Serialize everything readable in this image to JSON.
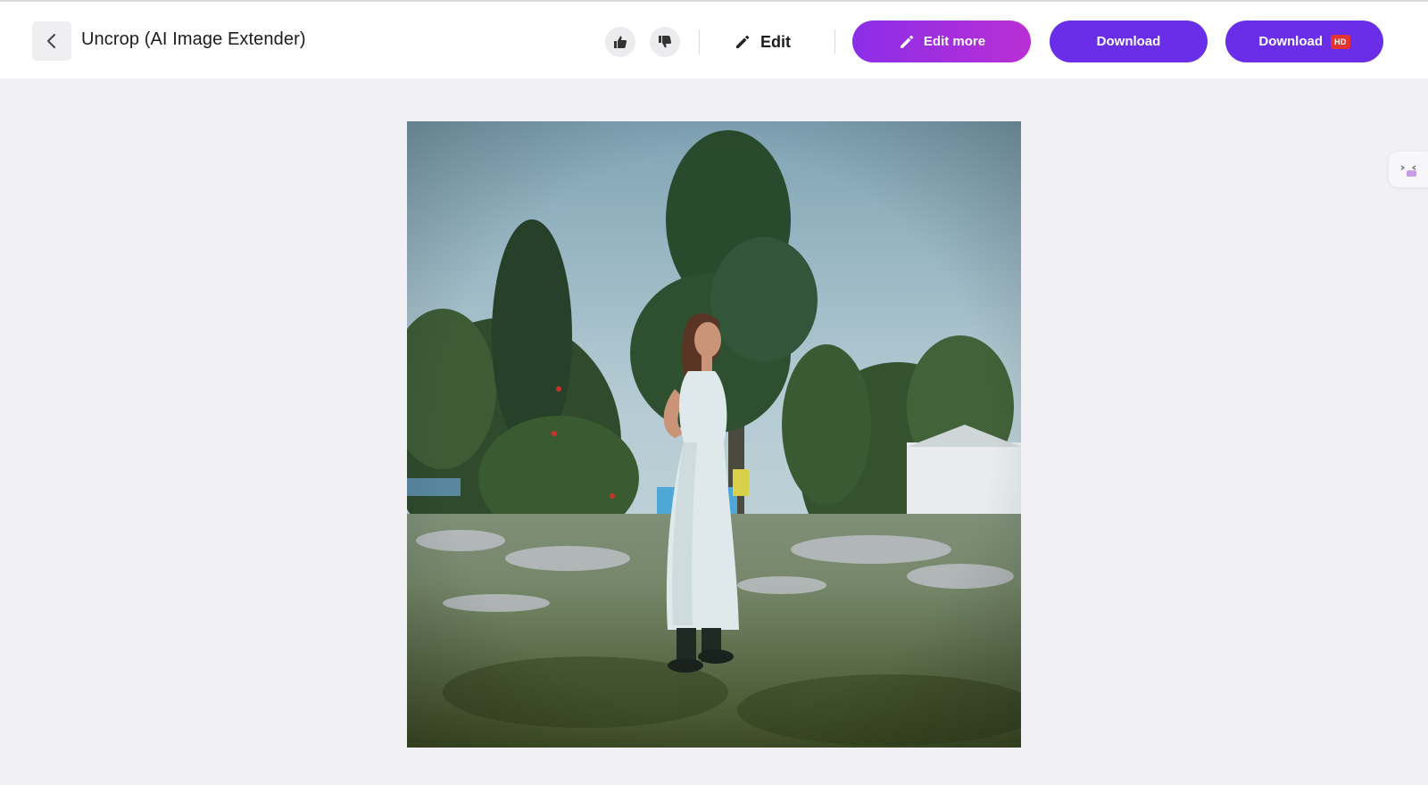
{
  "header": {
    "title": "Uncrop (AI Image Extender)",
    "edit_label": "Edit",
    "edit_more_label": "Edit more",
    "download_label": "Download",
    "download_hd_label": "Download",
    "hd_badge": "HD"
  },
  "icons": {
    "back": "chevron-left-icon",
    "like": "thumbs-up-icon",
    "dislike": "thumbs-down-icon",
    "edit": "pencil-icon",
    "edit_more": "pencil-icon",
    "side_widget": "expand-panel-icon"
  },
  "colors": {
    "primary": "#6a2ee8",
    "gradient_start": "#8b2ee8",
    "gradient_end": "#b92fd4",
    "hd_badge": "#e3342f",
    "canvas_bg": "#f0f0f5"
  }
}
